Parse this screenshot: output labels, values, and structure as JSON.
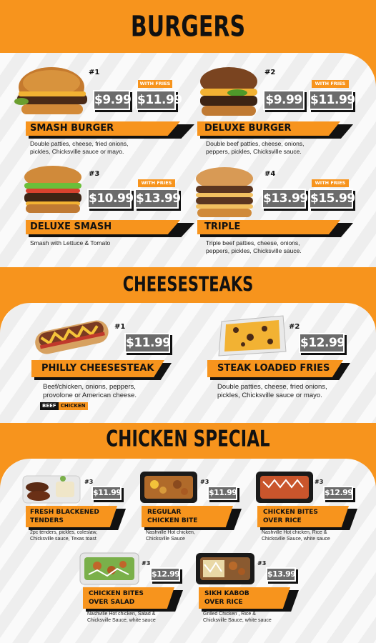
{
  "sections": {
    "burgers": "BURGERS",
    "cheesesteaks": "CHEESESTEAKS",
    "chicken": "CHICKEN SPECIAL"
  },
  "with_fries": "WITH FRIES",
  "burgers": [
    {
      "num": "#1",
      "name": "SMASH BURGER",
      "price": "$9.99",
      "fries_price": "$11.99",
      "desc": [
        "Double patties, cheese, fried onions,",
        "pickles, Chicksville sauce or mayo."
      ]
    },
    {
      "num": "#2",
      "name": "DELUXE BURGER",
      "price": "$9.99",
      "fries_price": "$11.99",
      "desc": [
        "Double beef patties, cheese, onions,",
        "peppers, pickles, Chicksville sauce."
      ]
    },
    {
      "num": "#3",
      "name": "DELUXE SMASH",
      "price": "$10.99",
      "fries_price": "$13.99",
      "desc": [
        "Smash with Lettuce & Tomato",
        ""
      ]
    },
    {
      "num": "#4",
      "name": "TRIPLE",
      "price": "$13.99",
      "fries_price": "$15.99",
      "desc": [
        "Triple beef patties, cheese, onions,",
        "peppers, pickles, Chicksville sauce."
      ]
    }
  ],
  "cheesesteaks": [
    {
      "num": "#1",
      "name": "PHILLY CHEESESTEAK",
      "price": "$11.99",
      "desc": [
        "Beef/chicken, onions, peppers,",
        "provolone or American cheese."
      ],
      "tags": [
        "BEEF",
        "CHICKEN"
      ]
    },
    {
      "num": "#2",
      "name": "STEAK LOADED FRIES",
      "price": "$12.99",
      "desc": [
        "Double patties, cheese, fried onions,",
        "pickles, Chicksville sauce or mayo."
      ]
    }
  ],
  "chicken": [
    {
      "num": "#3",
      "name": [
        "FRESH BLACKENED",
        "TENDERS"
      ],
      "price": "$11.99",
      "desc": [
        "2pc tenders, pickles, coleslaw,",
        "Chicksville sauce, Texas toast"
      ]
    },
    {
      "num": "#3",
      "name": [
        "REGULAR",
        "CHICKEN BITE"
      ],
      "price": "$11.99",
      "desc": [
        "Nashville Hot chicken,",
        "Chicksville Sauce"
      ]
    },
    {
      "num": "#3",
      "name": [
        "CHICKEN BITES",
        "OVER RICE"
      ],
      "price": "$12.99",
      "desc": [
        "Nashville Hot chicken,  Rice &",
        "Chicksville Sauce, white sauce"
      ]
    },
    {
      "num": "#3",
      "name": [
        "CHICKEN BITES",
        "OVER SALAD"
      ],
      "price": "$12.99",
      "desc": [
        "Nashville Hot chicken, Salad &",
        "Chicksville Sauce, white sauce"
      ]
    },
    {
      "num": "#3",
      "name": [
        "SIKH KABOB",
        "OVER RICE"
      ],
      "price": "$13.99",
      "desc": [
        "Grilled Chicken , Rice &",
        "Chicksville Sauce, white sauce"
      ]
    }
  ],
  "colors": {
    "orange": "#f7941d",
    "gray": "#6b6b6b",
    "black": "#111111"
  }
}
